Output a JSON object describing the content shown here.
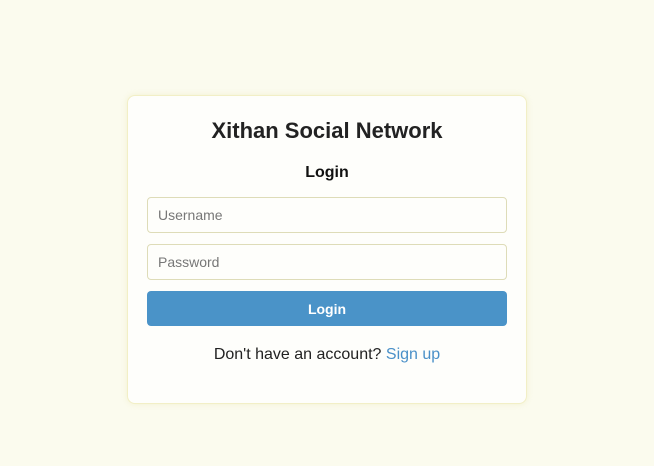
{
  "app": {
    "title": "Xithan Social Network"
  },
  "form": {
    "heading": "Login",
    "username": {
      "placeholder": "Username",
      "value": ""
    },
    "password": {
      "placeholder": "Password",
      "value": ""
    },
    "submit_label": "Login",
    "footer_text": "Don't have an account?",
    "signup_link": "Sign up"
  },
  "colors": {
    "accent": "#4a93c8",
    "link": "#4a90c8",
    "background": "#fbfbee"
  }
}
